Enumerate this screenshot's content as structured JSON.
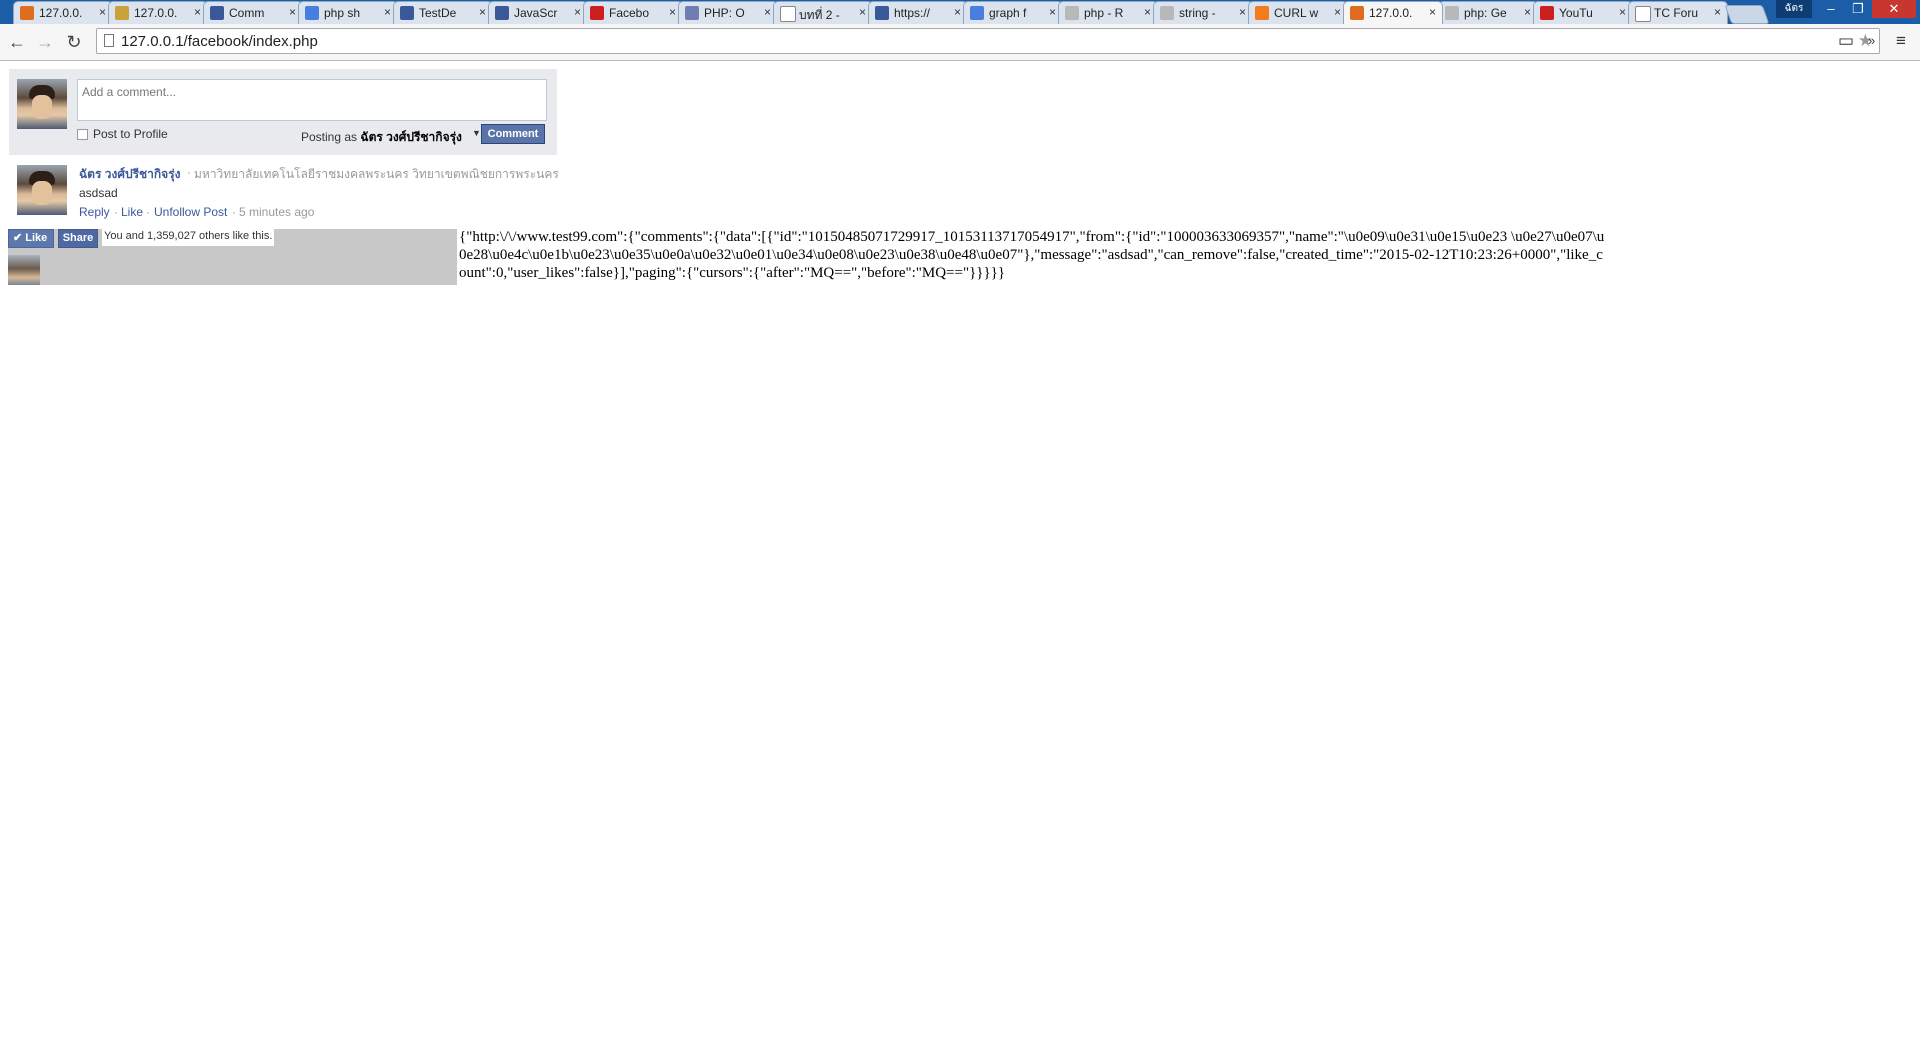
{
  "browser": {
    "tabs": [
      {
        "label": "127.0.0.",
        "icon": "orange-site-icon",
        "color": "#e06d1f"
      },
      {
        "label": "127.0.0.",
        "icon": "phpmyadmin-icon",
        "color": "#c9a23c"
      },
      {
        "label": "Comm",
        "icon": "facebook-icon",
        "color": "#3b5998"
      },
      {
        "label": "php sh",
        "icon": "google-icon",
        "color": "#4a7de0"
      },
      {
        "label": "TestDe",
        "icon": "facebook-icon",
        "color": "#3b5998"
      },
      {
        "label": "JavaScr",
        "icon": "facebook-icon",
        "color": "#3b5998"
      },
      {
        "label": "Facebo",
        "icon": "youtube-icon",
        "color": "#cc1f1f"
      },
      {
        "label": "PHP: O",
        "icon": "php-icon",
        "color": "#6f7db4"
      },
      {
        "label": "บทที่ 2 -",
        "icon": "page-icon",
        "color": "#ffffff"
      },
      {
        "label": "https://",
        "icon": "facebook-icon",
        "color": "#3b5998"
      },
      {
        "label": "graph f",
        "icon": "google-icon",
        "color": "#4a7de0"
      },
      {
        "label": "php - R",
        "icon": "stack-icon",
        "color": "#b8b8b8"
      },
      {
        "label": "string -",
        "icon": "stack-icon",
        "color": "#b8b8b8"
      },
      {
        "label": "CURL w",
        "icon": "blogger-icon",
        "color": "#f27b1f"
      },
      {
        "label": "127.0.0.",
        "icon": "orange-site-icon",
        "color": "#e06d1f"
      },
      {
        "label": "php: Ge",
        "icon": "stack-icon",
        "color": "#b8b8b8"
      },
      {
        "label": "YouTu",
        "icon": "youtube-icon",
        "color": "#cc1f1f"
      },
      {
        "label": "TC Foru",
        "icon": "page-icon",
        "color": "#ffffff"
      }
    ],
    "active_tab_index": 14,
    "profile_label": "ฉัตร",
    "url": "127.0.0.1/facebook/index.php"
  },
  "composer": {
    "placeholder": "Add a comment...",
    "post_to_profile_label": "Post to Profile",
    "posting_as_prefix": "Posting as",
    "posting_as_name": "ฉัตร วงศ์ปรีชากิจรุ่ง",
    "comment_button": "Comment"
  },
  "comment": {
    "author": "ฉัตร วงศ์ปรีชากิจรุ่ง",
    "separator": "·",
    "affiliation": "มหาวิทยาลัยเทคโนโลยีราชมงคลพระนคร วิทยาเขตพณิชยการพระนคร",
    "text": "asdsad",
    "actions": [
      "Reply",
      "Like",
      "Unfollow Post"
    ],
    "time": "5 minutes ago"
  },
  "like_box": {
    "like_label": "Like",
    "share_label": "Share",
    "count_text": "You and 1,359,027 others like this."
  },
  "json_output": "{\"http:\\/\\/www.test99.com\":{\"comments\":{\"data\":[{\"id\":\"10150485071729917_10153113717054917\",\"from\":{\"id\":\"100003633069357\",\"name\":\"\\u0e09\\u0e31\\u0e15\\u0e23 \\u0e27\\u0e07\\u0e28\\u0e4c\\u0e1b\\u0e23\\u0e35\\u0e0a\\u0e32\\u0e01\\u0e34\\u0e08\\u0e23\\u0e38\\u0e48\\u0e07\"},\"message\":\"asdsad\",\"can_remove\":false,\"created_time\":\"2015-02-12T10:23:26+0000\",\"like_count\":0,\"user_likes\":false}],\"paging\":{\"cursors\":{\"after\":\"MQ==\",\"before\":\"MQ==\"}}}}}"
}
